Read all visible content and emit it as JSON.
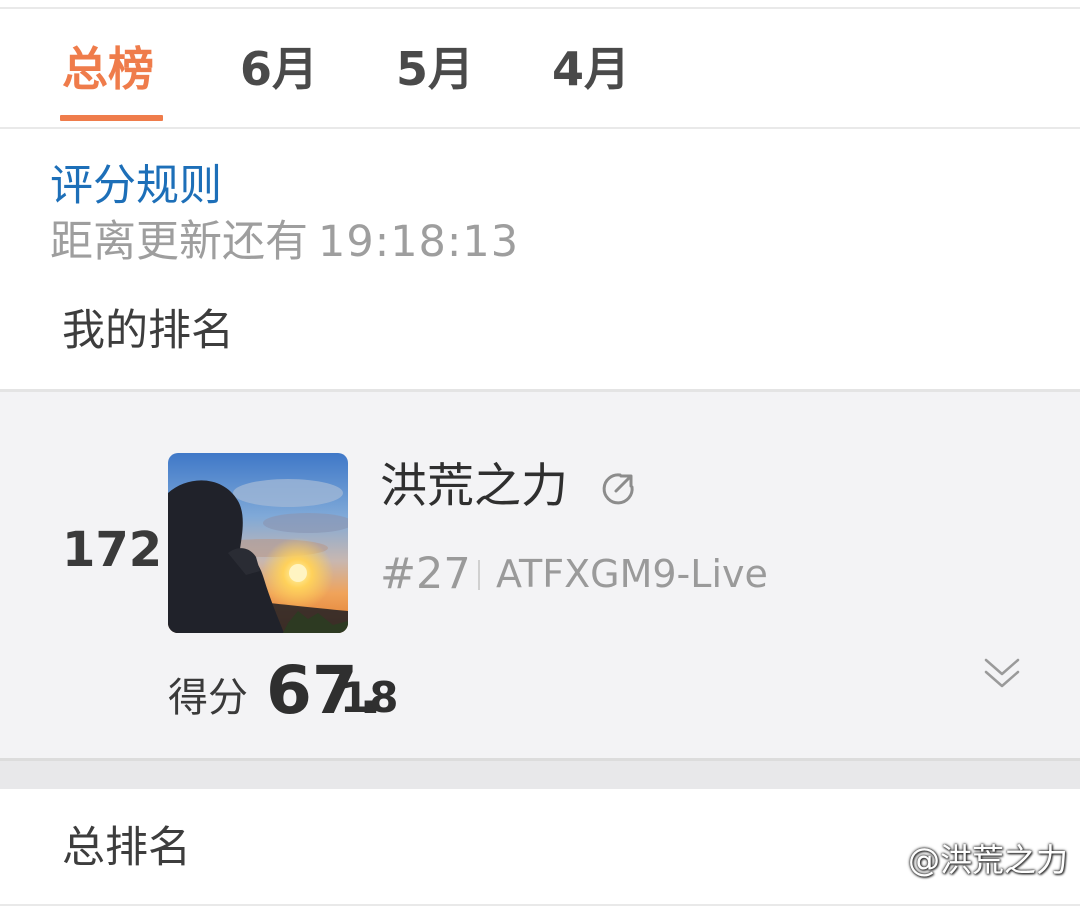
{
  "tabs": [
    {
      "label": "总榜",
      "active": true
    },
    {
      "label": "6月",
      "active": false
    },
    {
      "label": "5月",
      "active": false
    },
    {
      "label": "4月",
      "active": false
    }
  ],
  "rules_link": "评分规则",
  "countdown": {
    "label": "距离更新还有",
    "time": "19:18:13"
  },
  "my_ranking": {
    "section_title": "我的排名",
    "rank": "172",
    "username": "洪荒之力",
    "sub_rank": "#27",
    "account": "ATFXGM9-Live",
    "score_label": "得分",
    "score_integer": "67.",
    "score_decimal": "18"
  },
  "total_ranking": {
    "section_title": "总排名"
  },
  "watermark": "@洪荒之力",
  "colors": {
    "accent": "#ef7c4b",
    "link": "#1d6fb8",
    "muted": "#9e9e9e"
  },
  "icons": [
    "external-link-icon",
    "chevron-down-double-icon",
    "weibo-logo-icon"
  ]
}
